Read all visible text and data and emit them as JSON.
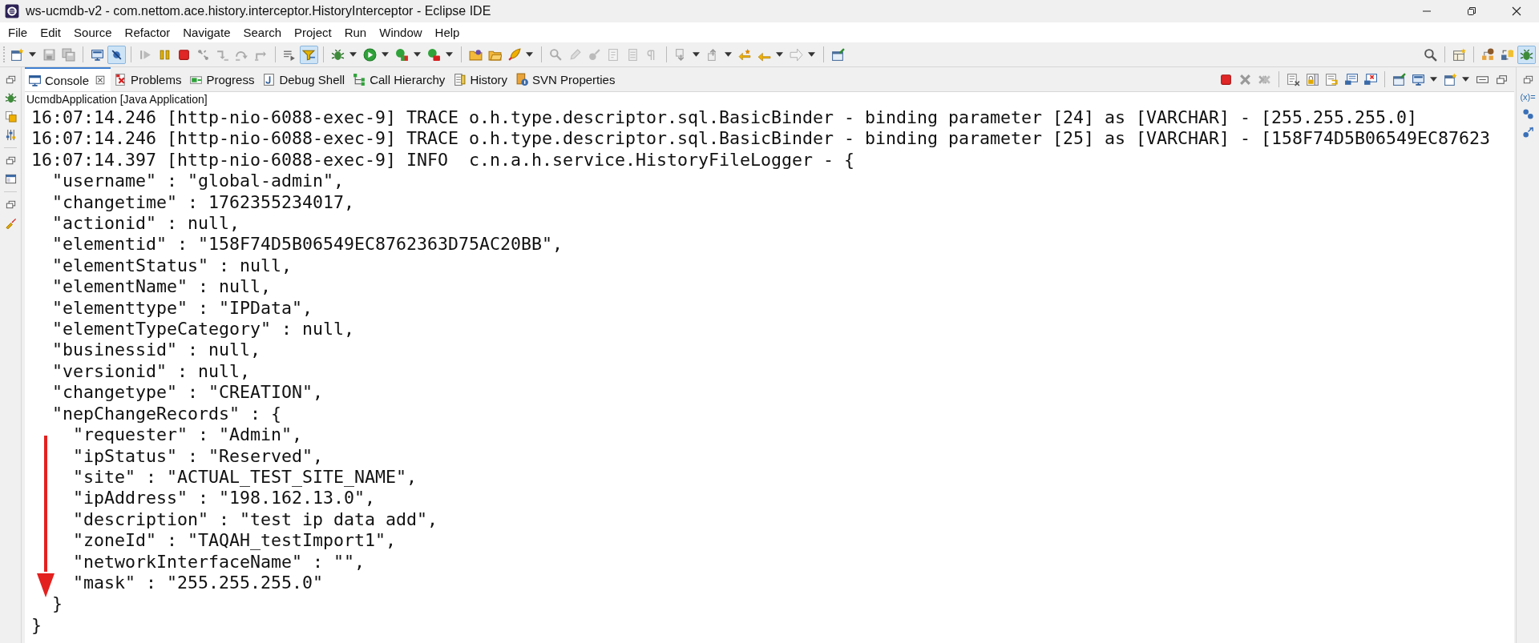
{
  "window": {
    "title": "ws-ucmdb-v2 - com.nettom.ace.history.interceptor.HistoryInterceptor - Eclipse IDE"
  },
  "menu": [
    "File",
    "Edit",
    "Source",
    "Refactor",
    "Navigate",
    "Search",
    "Project",
    "Run",
    "Window",
    "Help"
  ],
  "toolbar": [
    {
      "kind": "new",
      "dropdown": true,
      "pressed": false
    },
    {
      "kind": "save",
      "dropdown": false,
      "pressed": false
    },
    {
      "kind": "saveall",
      "dropdown": false,
      "pressed": false
    },
    {
      "kind": "sep"
    },
    {
      "kind": "monitor",
      "dropdown": false,
      "pressed": false
    },
    {
      "kind": "skip",
      "dropdown": false,
      "pressed": true
    },
    {
      "kind": "sep"
    },
    {
      "kind": "resume",
      "dropdown": false,
      "pressed": false
    },
    {
      "kind": "suspend",
      "dropdown": false,
      "pressed": false
    },
    {
      "kind": "stop",
      "dropdown": false,
      "pressed": false
    },
    {
      "kind": "disconnect",
      "dropdown": false,
      "pressed": false
    },
    {
      "kind": "stepinto",
      "dropdown": false,
      "pressed": false
    },
    {
      "kind": "stepover",
      "dropdown": false,
      "pressed": false
    },
    {
      "kind": "stepreturn",
      "dropdown": false,
      "pressed": false
    },
    {
      "kind": "sep"
    },
    {
      "kind": "dropframe",
      "dropdown": false,
      "pressed": false
    },
    {
      "kind": "filter",
      "dropdown": false,
      "pressed": true
    },
    {
      "kind": "sep"
    },
    {
      "kind": "bug",
      "dropdown": true,
      "pressed": false
    },
    {
      "kind": "run",
      "dropdown": true,
      "pressed": false
    },
    {
      "kind": "coverage",
      "dropdown": true,
      "pressed": false
    },
    {
      "kind": "external",
      "dropdown": true,
      "pressed": false
    },
    {
      "kind": "sep"
    },
    {
      "kind": "folder",
      "dropdown": false,
      "pressed": false
    },
    {
      "kind": "openfile",
      "dropdown": false,
      "pressed": false
    },
    {
      "kind": "rocket",
      "dropdown": true,
      "pressed": false
    },
    {
      "kind": "sep"
    },
    {
      "kind": "annotation",
      "dropdown": false,
      "pressed": false
    },
    {
      "kind": "pencil",
      "dropdown": false,
      "pressed": false
    },
    {
      "kind": "mark",
      "dropdown": false,
      "pressed": false
    },
    {
      "kind": "document",
      "dropdown": false,
      "pressed": false
    },
    {
      "kind": "page",
      "dropdown": false,
      "pressed": false
    },
    {
      "kind": "pilcrow",
      "dropdown": false,
      "pressed": false
    },
    {
      "kind": "sep"
    },
    {
      "kind": "nextannot",
      "dropdown": true,
      "pressed": false
    },
    {
      "kind": "prevannot",
      "dropdown": true,
      "pressed": false
    },
    {
      "kind": "lastedit",
      "dropdown": false,
      "pressed": false
    },
    {
      "kind": "back",
      "dropdown": true,
      "pressed": false
    },
    {
      "kind": "forward",
      "dropdown": true,
      "pressed": false
    },
    {
      "kind": "sep"
    },
    {
      "kind": "pin",
      "dropdown": false,
      "pressed": false
    }
  ],
  "toolbar_right": [
    {
      "kind": "search",
      "pressed": false
    },
    {
      "kind": "sep"
    },
    {
      "kind": "perspective",
      "pressed": false
    },
    {
      "kind": "sep"
    },
    {
      "kind": "hierarchy",
      "pressed": false
    },
    {
      "kind": "team",
      "pressed": false
    },
    {
      "kind": "bug",
      "pressed": true
    }
  ],
  "tabs": [
    {
      "label": "Console",
      "kind": "console",
      "selected": true,
      "closable": true
    },
    {
      "label": "Problems",
      "kind": "problems",
      "selected": false,
      "closable": false
    },
    {
      "label": "Progress",
      "kind": "progress",
      "selected": false,
      "closable": false
    },
    {
      "label": "Debug Shell",
      "kind": "shell",
      "selected": false,
      "closable": false
    },
    {
      "label": "Call Hierarchy",
      "kind": "hierarchy",
      "selected": false,
      "closable": false
    },
    {
      "label": "History",
      "kind": "history",
      "selected": false,
      "closable": false
    },
    {
      "label": "SVN Properties",
      "kind": "svn",
      "selected": false,
      "closable": false
    }
  ],
  "view_toolbar": [
    {
      "kind": "stop",
      "dropdown": false
    },
    {
      "kind": "remove",
      "dropdown": false
    },
    {
      "kind": "removeall",
      "dropdown": false
    },
    {
      "kind": "sep"
    },
    {
      "kind": "doccross",
      "dropdown": false
    },
    {
      "kind": "lock",
      "dropdown": false
    },
    {
      "kind": "wrap",
      "dropdown": false
    },
    {
      "kind": "consolemsg",
      "dropdown": false
    },
    {
      "kind": "consolecross",
      "dropdown": false
    },
    {
      "kind": "sep"
    },
    {
      "kind": "pin",
      "dropdown": false
    },
    {
      "kind": "monitor",
      "dropdown": true
    },
    {
      "kind": "new",
      "dropdown": true
    },
    {
      "kind": "minimize",
      "dropdown": false
    },
    {
      "kind": "maximize",
      "dropdown": false
    }
  ],
  "process_label": "UcmdbApplication [Java Application]",
  "console_lines": [
    "16:07:14.246 [http-nio-6088-exec-9] TRACE o.h.type.descriptor.sql.BasicBinder - binding parameter [24] as [VARCHAR] - [255.255.255.0]",
    "16:07:14.246 [http-nio-6088-exec-9] TRACE o.h.type.descriptor.sql.BasicBinder - binding parameter [25] as [VARCHAR] - [158F74D5B06549EC87623",
    "16:07:14.397 [http-nio-6088-exec-9] INFO  c.n.a.h.service.HistoryFileLogger - {",
    "  \"username\" : \"global-admin\",",
    "  \"changetime\" : 1762355234017,",
    "  \"actionid\" : null,",
    "  \"elementid\" : \"158F74D5B06549EC8762363D75AC20BB\",",
    "  \"elementStatus\" : null,",
    "  \"elementName\" : null,",
    "  \"elementtype\" : \"IPData\",",
    "  \"elementTypeCategory\" : null,",
    "  \"businessid\" : null,",
    "  \"versionid\" : null,",
    "  \"changetype\" : \"CREATION\",",
    "  \"nepChangeRecords\" : {",
    "    \"requester\" : \"Admin\",",
    "    \"ipStatus\" : \"Reserved\",",
    "    \"site\" : \"ACTUAL_TEST_SITE_NAME\",",
    "    \"ipAddress\" : \"198.162.13.0\",",
    "    \"description\" : \"test ip data add\",",
    "    \"zoneId\" : \"TAQAH_testImport1\",",
    "    \"networkInterfaceName\" : \"\",",
    "    \"mask\" : \"255.255.255.0\"",
    "  }",
    "}"
  ],
  "right_trim": {
    "label": "(x)="
  }
}
